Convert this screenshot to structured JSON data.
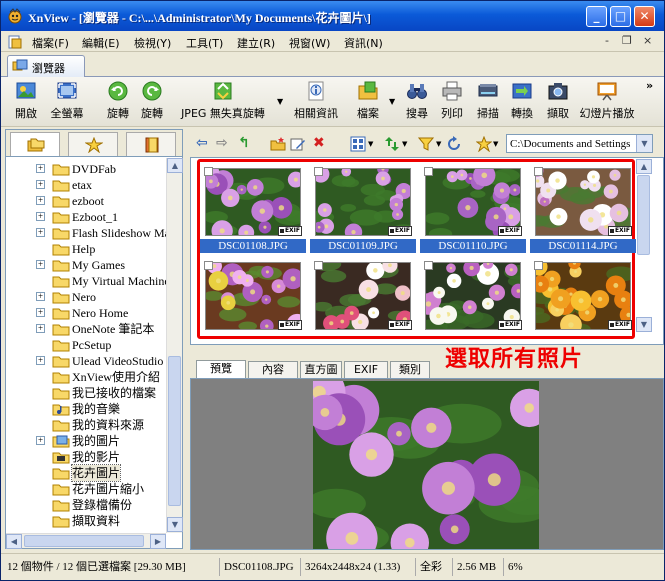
{
  "window": {
    "title": "XnView - [瀏覽器 - C:\\...\\Administrator\\My Documents\\花卉圖片\\]",
    "controls": {
      "minimize": "_",
      "maximize": "□",
      "close": "✕"
    }
  },
  "menubar": {
    "items": [
      "檔案(F)",
      "編輯(E)",
      "檢視(Y)",
      "工具(T)",
      "建立(R)",
      "視窗(W)",
      "資訊(N)"
    ],
    "mdi_controls": [
      "-",
      "❐",
      "×"
    ]
  },
  "tabs": {
    "browser": "瀏覽器"
  },
  "toolbar": {
    "buttons": [
      "開啟",
      "全螢幕",
      "旋轉",
      "旋轉",
      "JPEG 無失真旋轉",
      "相關資訊",
      "檔案",
      "搜尋",
      "列印",
      "掃描",
      "轉換",
      "擷取",
      "幻燈片播放"
    ],
    "overflow": "»"
  },
  "folder_tree": {
    "items": [
      {
        "label": "DVDFab",
        "expander": "+"
      },
      {
        "label": "etax",
        "expander": "+"
      },
      {
        "label": "ezboot",
        "expander": "+"
      },
      {
        "label": "Ezboot_1",
        "expander": "+"
      },
      {
        "label": "Flash Slideshow Ma",
        "expander": "+"
      },
      {
        "label": "Help",
        "expander": ""
      },
      {
        "label": "My Games",
        "expander": "+"
      },
      {
        "label": "My Virtual Machine",
        "expander": ""
      },
      {
        "label": "Nero",
        "expander": "+"
      },
      {
        "label": "Nero Home",
        "expander": "+"
      },
      {
        "label": "OneNote 筆記本",
        "expander": "+"
      },
      {
        "label": "PcSetup",
        "expander": ""
      },
      {
        "label": "Ulead VideoStudio",
        "expander": "+"
      },
      {
        "label": "XnView使用介紹",
        "expander": ""
      },
      {
        "label": "我已接收的檔案",
        "expander": ""
      },
      {
        "label": "我的音樂",
        "expander": ""
      },
      {
        "label": "我的資料來源",
        "expander": ""
      },
      {
        "label": "我的圖片",
        "expander": "+"
      },
      {
        "label": "我的影片",
        "expander": ""
      },
      {
        "label": "花卉圖片",
        "expander": ""
      },
      {
        "label": "花卉圖片縮小",
        "expander": ""
      },
      {
        "label": "登錄檔備份",
        "expander": ""
      },
      {
        "label": "擷取資料",
        "expander": ""
      }
    ],
    "selected": "花卉圖片"
  },
  "nav": {
    "path": "C:\\Documents and Settings"
  },
  "thumbnails": [
    {
      "name": "DSC01108.JPG",
      "badge": "EXIF",
      "scene": "purple"
    },
    {
      "name": "DSC01109.JPG",
      "badge": "EXIF",
      "scene": "purple"
    },
    {
      "name": "DSC01110.JPG",
      "badge": "EXIF",
      "scene": "purple"
    },
    {
      "name": "DSC01114.JPG",
      "badge": "EXIF",
      "scene": "orchid"
    },
    {
      "name": "",
      "badge": "EXIF",
      "scene": "pot"
    },
    {
      "name": "",
      "badge": "EXIF",
      "scene": "pink"
    },
    {
      "name": "",
      "badge": "EXIF",
      "scene": "white"
    },
    {
      "name": "",
      "badge": "EXIF",
      "scene": "orange"
    }
  ],
  "annotation": "選取所有照片",
  "preview_tabs": [
    "預覽",
    "內容",
    "直方圖",
    "EXIF",
    "類別"
  ],
  "status": {
    "count": "12 個物件 / 12 個已選檔案  [29.30 MB]",
    "file": "DSC01108.JPG",
    "dims": "3264x2448x24 (1.33)",
    "color": "全彩",
    "size": "2.56 MB",
    "zoom": "6%"
  },
  "colors": {
    "title_bar": "#0b5ad8",
    "selection": "#3169c6",
    "annotation": "#ee0000"
  }
}
